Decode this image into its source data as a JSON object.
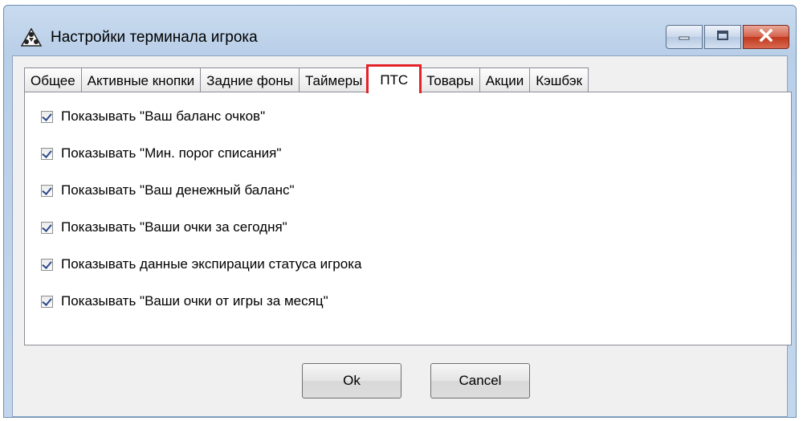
{
  "window": {
    "title": "Настройки терминала игрока",
    "app_icon": "people-group-icon",
    "controls": {
      "minimize": "minimize-icon",
      "maximize": "maximize-icon",
      "close": "close-icon"
    }
  },
  "tabs": [
    {
      "label": "Общее"
    },
    {
      "label": "Активные кнопки"
    },
    {
      "label": "Задние фоны"
    },
    {
      "label": "Таймеры"
    },
    {
      "label": "ПТС",
      "active": true
    },
    {
      "label": "Товары"
    },
    {
      "label": "Акции"
    },
    {
      "label": "Кэшбэк"
    }
  ],
  "checkboxes": [
    {
      "label": "Показывать \"Ваш баланс очков\"",
      "checked": true
    },
    {
      "label": "Показывать \"Мин. порог списания\"",
      "checked": true
    },
    {
      "label": "Показывать \"Ваш денежный баланс\"",
      "checked": true
    },
    {
      "label": "Показывать \"Ваши очки за сегодня\"",
      "checked": true
    },
    {
      "label": "Показывать данные экспирации статуса игрока",
      "checked": true
    },
    {
      "label": "Показывать \"Ваши очки от игры за месяц\"",
      "checked": true
    }
  ],
  "buttons": {
    "ok": "Ok",
    "cancel": "Cancel"
  },
  "colors": {
    "highlight": "#e3232a",
    "titlebar": "#b9cfe8"
  }
}
